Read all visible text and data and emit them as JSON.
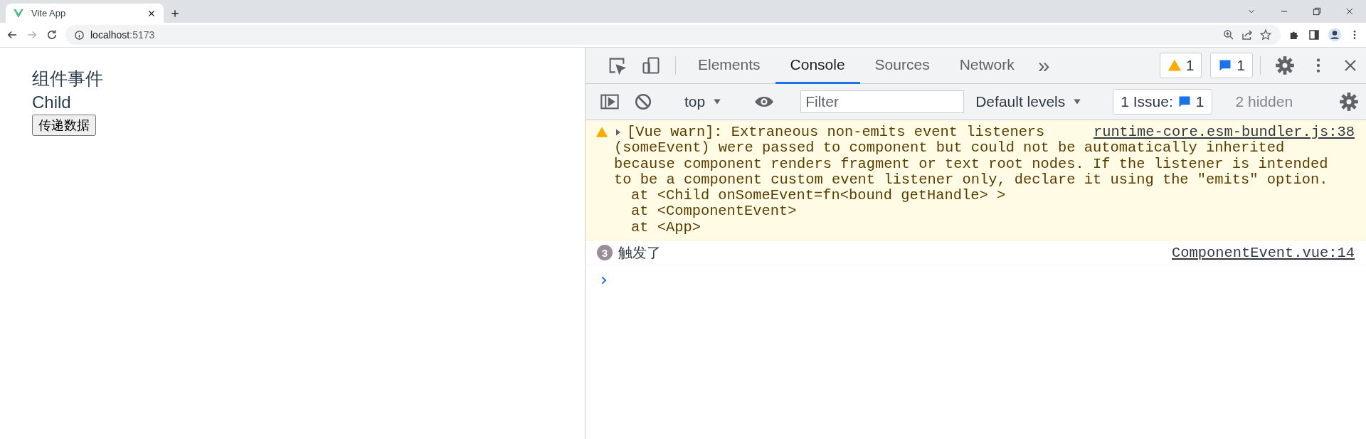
{
  "browser": {
    "tab": {
      "title": "Vite App"
    },
    "address": {
      "host": "localhost",
      "port": ":5173"
    }
  },
  "page": {
    "heading": "组件事件",
    "child_label": "Child",
    "button": "传递数据"
  },
  "devtools": {
    "tabs": [
      {
        "label": "Elements",
        "selected": false
      },
      {
        "label": "Console",
        "selected": true
      },
      {
        "label": "Sources",
        "selected": false
      },
      {
        "label": "Network",
        "selected": false
      }
    ],
    "more_tabs": "»",
    "warning_count": "1",
    "message_count": "1",
    "console_toolbar": {
      "context": "top",
      "filter": {
        "placeholder": "Filter"
      },
      "levels": "Default levels",
      "issues_label": "1 Issue:",
      "issues_count": "1",
      "hidden": "2 hidden"
    },
    "messages": [
      {
        "kind": "warning",
        "expanded": false,
        "source": "runtime-core.esm-bundler.js:38",
        "lines": [
          "[Vue warn]: Extraneous non-emits event listeners",
          "(someEvent) were passed to component but could not be automatically inherited",
          "because component renders fragment or text root nodes. If the listener is intended",
          "to be a component custom event listener only, declare it using the \"emits\" option."
        ],
        "trace": [
          "at <Child onSomeEvent=fn<bound getHandle> >",
          "at <ComponentEvent>",
          "at <App>"
        ]
      },
      {
        "kind": "log",
        "count": "3",
        "text": "触发了",
        "source": "ComponentEvent.vue:14"
      }
    ]
  }
}
